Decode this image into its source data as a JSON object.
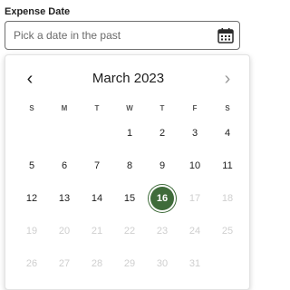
{
  "field": {
    "label": "Expense Date",
    "placeholder": "Pick a date in the past",
    "value": ""
  },
  "calendar": {
    "month_title": "March 2023",
    "prev_glyph": "‹",
    "next_glyph": "›",
    "weekdays": [
      "S",
      "M",
      "T",
      "W",
      "T",
      "F",
      "S"
    ],
    "first_weekday_index": 3,
    "days": [
      {
        "label": "1",
        "state": "enabled"
      },
      {
        "label": "2",
        "state": "enabled"
      },
      {
        "label": "3",
        "state": "enabled"
      },
      {
        "label": "4",
        "state": "enabled"
      },
      {
        "label": "5",
        "state": "enabled"
      },
      {
        "label": "6",
        "state": "enabled"
      },
      {
        "label": "7",
        "state": "enabled"
      },
      {
        "label": "8",
        "state": "enabled"
      },
      {
        "label": "9",
        "state": "enabled"
      },
      {
        "label": "10",
        "state": "enabled"
      },
      {
        "label": "11",
        "state": "enabled"
      },
      {
        "label": "12",
        "state": "enabled"
      },
      {
        "label": "13",
        "state": "enabled"
      },
      {
        "label": "14",
        "state": "enabled"
      },
      {
        "label": "15",
        "state": "enabled"
      },
      {
        "label": "16",
        "state": "selected"
      },
      {
        "label": "17",
        "state": "disabled"
      },
      {
        "label": "18",
        "state": "disabled"
      },
      {
        "label": "19",
        "state": "disabled"
      },
      {
        "label": "20",
        "state": "disabled"
      },
      {
        "label": "21",
        "state": "disabled"
      },
      {
        "label": "22",
        "state": "disabled"
      },
      {
        "label": "23",
        "state": "disabled"
      },
      {
        "label": "24",
        "state": "disabled"
      },
      {
        "label": "25",
        "state": "disabled"
      },
      {
        "label": "26",
        "state": "disabled"
      },
      {
        "label": "27",
        "state": "disabled"
      },
      {
        "label": "28",
        "state": "disabled"
      },
      {
        "label": "29",
        "state": "disabled"
      },
      {
        "label": "30",
        "state": "disabled"
      },
      {
        "label": "31",
        "state": "disabled"
      }
    ]
  },
  "colors": {
    "selected_fill": "#3f6b3a",
    "disabled_text": "#cfcfcf",
    "input_border": "#6f6f6f"
  },
  "icons": {
    "calendar": "calendar-icon",
    "prev": "chevron-left-icon",
    "next": "chevron-right-icon"
  }
}
